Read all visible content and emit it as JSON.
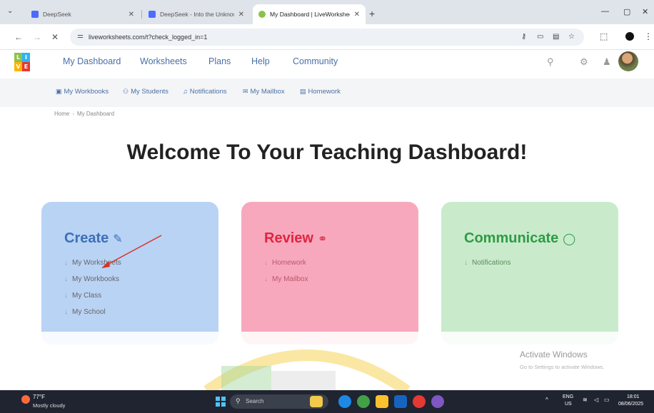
{
  "browser": {
    "tabs": [
      {
        "title": "DeepSeek"
      },
      {
        "title": "DeepSeek - Into the Unknown"
      },
      {
        "title": "My Dashboard | LiveWorksheet"
      }
    ],
    "url": "liveworksheets.com/t?check_logged_in=1"
  },
  "site": {
    "logo_letters": [
      "L",
      "I",
      "V",
      "E"
    ],
    "nav": [
      "My Dashboard",
      "Worksheets",
      "Plans",
      "Help",
      "Community"
    ],
    "subnav": [
      {
        "label": "My Workbooks",
        "icon": "book-icon"
      },
      {
        "label": "My Students",
        "icon": "students-icon"
      },
      {
        "label": "Notifications",
        "icon": "bell-icon"
      },
      {
        "label": "My Mailbox",
        "icon": "mail-icon"
      },
      {
        "label": "Homework",
        "icon": "homework-icon"
      }
    ],
    "breadcrumb": [
      "Home",
      "My Dashboard"
    ]
  },
  "page": {
    "title": "Welcome To Your Teaching Dashboard!"
  },
  "cards": [
    {
      "title": "Create",
      "color": "#b9d3f5",
      "title_color": "#3d6fb6",
      "icon": "pencil-icon",
      "links": [
        "My Worksheets",
        "My Workbooks",
        "My Class",
        "My School"
      ]
    },
    {
      "title": "Review",
      "color": "#f8a8bd",
      "title_color": "#e0243f",
      "icon": "binoculars-icon",
      "links": [
        "Homework",
        "My Mailbox"
      ]
    },
    {
      "title": "Communicate",
      "color": "#c9ebcb",
      "title_color": "#2e9b45",
      "icon": "speech-bubble-icon",
      "links": [
        "Notifications"
      ]
    }
  ],
  "watermark": {
    "title": "Activate Windows",
    "subtitle": "Go to Settings to activate Windows."
  },
  "taskbar": {
    "temp": "77°F",
    "weather": "Mostly cloudy",
    "search": "Search",
    "lang": "ENG",
    "region": "US",
    "time": "18:01",
    "date": "08/06/2025"
  }
}
